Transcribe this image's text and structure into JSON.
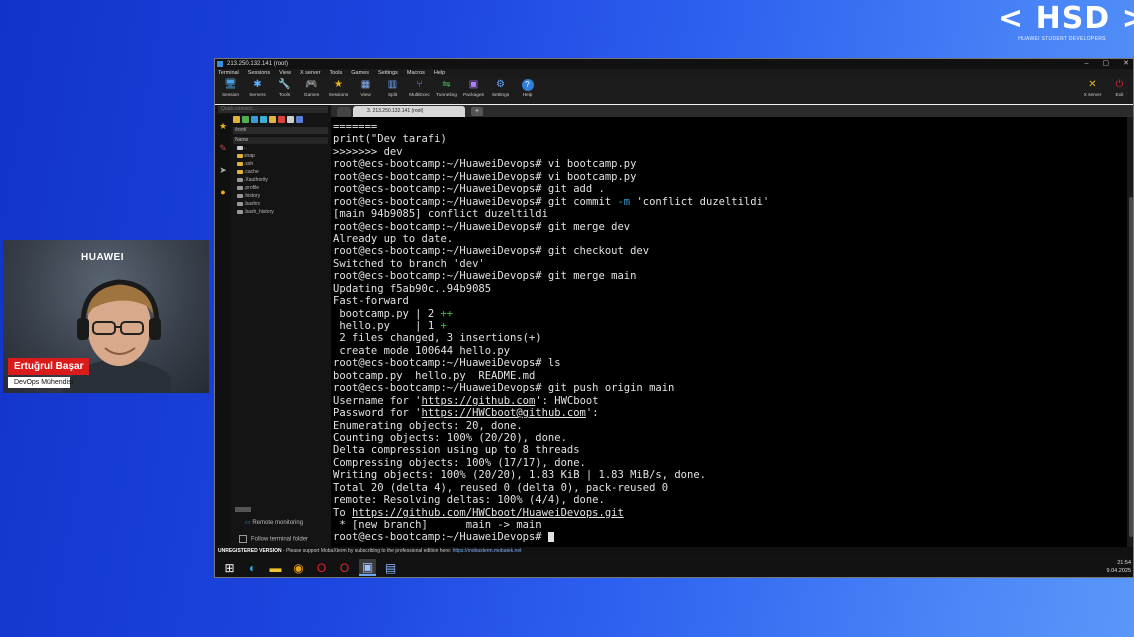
{
  "overlay": {
    "logo": "< HSD >",
    "logo_sub": "HUAWEI STUDENT DEVELOPERS"
  },
  "presenter": {
    "brand": "HUAWEI",
    "name": "Ertuğrul Başar",
    "role": "DevOps Mühendisi"
  },
  "window": {
    "title": "213.250.132.141 (root)",
    "controls": [
      "–",
      "▢",
      "✕"
    ]
  },
  "menu": [
    "Terminal",
    "Sessions",
    "View",
    "X server",
    "Tools",
    "Games",
    "Settings",
    "Macros",
    "Help"
  ],
  "toolbar": {
    "buttons": [
      {
        "label": "Session",
        "icon": "session-icon",
        "glyph": "🖥"
      },
      {
        "label": "Servers",
        "icon": "servers-icon",
        "glyph": "✱"
      },
      {
        "label": "Tools",
        "icon": "tools-icon",
        "glyph": "🔧"
      },
      {
        "label": "Games",
        "icon": "games-icon",
        "glyph": "🎮"
      },
      {
        "label": "Sessions",
        "icon": "star-icon",
        "glyph": "★"
      },
      {
        "label": "View",
        "icon": "view-icon",
        "glyph": "▦"
      },
      {
        "label": "Split",
        "icon": "split-icon",
        "glyph": "▥"
      },
      {
        "label": "MultiExec",
        "icon": "multiexec-icon",
        "glyph": "⑂"
      },
      {
        "label": "Tunneling",
        "icon": "tunneling-icon",
        "glyph": "⇋"
      },
      {
        "label": "Packages",
        "icon": "packages-icon",
        "glyph": "▣"
      },
      {
        "label": "Settings",
        "icon": "settings-icon",
        "glyph": "⚙"
      },
      {
        "label": "Help",
        "icon": "help-icon",
        "glyph": "?"
      }
    ],
    "right": [
      {
        "label": "X server",
        "icon": "xserver-icon",
        "glyph": "✕"
      },
      {
        "label": "Exit",
        "icon": "exit-icon",
        "glyph": "⏻"
      }
    ]
  },
  "sidebar": {
    "quick_connect_placeholder": "Quick connect...",
    "path": "/root/",
    "tree_header": "Name",
    "items": [
      {
        "name": "..",
        "color": "#cccccc"
      },
      {
        "name": "snap",
        "color": "#e0b33a"
      },
      {
        "name": ".ssh",
        "color": "#e0b33a"
      },
      {
        "name": ".cache",
        "color": "#e0b33a"
      },
      {
        "name": ".Xauthority",
        "color": "#9a9a9a"
      },
      {
        "name": ".profile",
        "color": "#9a9a9a"
      },
      {
        "name": ".history",
        "color": "#9a9a9a"
      },
      {
        "name": ".bashrc",
        "color": "#9a9a9a"
      },
      {
        "name": ".bash_history",
        "color": "#9a9a9a"
      }
    ],
    "remote_monitoring": "Remote monitoring",
    "follow_folder": "Follow terminal folder"
  },
  "tab": {
    "label": "3. 213.250.132.141 (root)"
  },
  "terminal": {
    "lines": [
      [
        {
          "t": "======="
        }
      ],
      [
        {
          "t": "print(\"Dev tarafi)"
        }
      ],
      [
        {
          "t": ">>>>>>> dev"
        }
      ],
      [
        {
          "t": "root@ecs-bootcamp:~/HuaweiDevops# vi bootcamp.py"
        }
      ],
      [
        {
          "t": "root@ecs-bootcamp:~/HuaweiDevops# vi bootcamp.py"
        }
      ],
      [
        {
          "t": "root@ecs-bootcamp:~/HuaweiDevops# git add ."
        }
      ],
      [
        {
          "t": "root@ecs-bootcamp:~/HuaweiDevops# git commit "
        },
        {
          "t": "-m",
          "c": "c"
        },
        {
          "t": " 'conflict duzeltildi'"
        }
      ],
      [
        {
          "t": "[main 94b9085] conflict duzeltildi"
        }
      ],
      [
        {
          "t": "root@ecs-bootcamp:~/HuaweiDevops# git merge dev"
        }
      ],
      [
        {
          "t": "Already up to date."
        }
      ],
      [
        {
          "t": "root@ecs-bootcamp:~/HuaweiDevops# git checkout dev"
        }
      ],
      [
        {
          "t": "Switched to branch 'dev'"
        }
      ],
      [
        {
          "t": "root@ecs-bootcamp:~/HuaweiDevops# git merge main"
        }
      ],
      [
        {
          "t": "Updating f5ab90c..94b9085"
        }
      ],
      [
        {
          "t": "Fast-forward"
        }
      ],
      [
        {
          "t": " bootcamp.py | 2 "
        },
        {
          "t": "++",
          "c": "g"
        }
      ],
      [
        {
          "t": " hello.py    | 1 "
        },
        {
          "t": "+",
          "c": "g"
        }
      ],
      [
        {
          "t": " 2 files changed, 3 insertions(+)"
        }
      ],
      [
        {
          "t": " create mode 100644 hello.py"
        }
      ],
      [
        {
          "t": "root@ecs-bootcamp:~/HuaweiDevops# ls"
        }
      ],
      [
        {
          "t": "bootcamp.py  hello.py  README.md"
        }
      ],
      [
        {
          "t": "root@ecs-bootcamp:~/HuaweiDevops# git push origin main"
        }
      ],
      [
        {
          "t": "Username for '"
        },
        {
          "t": "https://github.com",
          "c": "u"
        },
        {
          "t": "': HWCboot"
        }
      ],
      [
        {
          "t": "Password for '"
        },
        {
          "t": "https://HWCboot@github.com",
          "c": "u"
        },
        {
          "t": "':"
        }
      ],
      [
        {
          "t": "Enumerating objects: 20, done."
        }
      ],
      [
        {
          "t": "Counting objects: 100% (20/20), done."
        }
      ],
      [
        {
          "t": "Delta compression using up to 8 threads"
        }
      ],
      [
        {
          "t": "Compressing objects: 100% (17/17), done."
        }
      ],
      [
        {
          "t": "Writing objects: 100% (20/20), 1.83 KiB | 1.83 MiB/s, done."
        }
      ],
      [
        {
          "t": "Total 20 (delta 4), reused 0 (delta 0), pack-reused 0"
        }
      ],
      [
        {
          "t": "remote: Resolving deltas: 100% (4/4), done."
        }
      ],
      [
        {
          "t": "To "
        },
        {
          "t": "https://github.com/HWCboot/HuaweiDevops.git",
          "c": "u"
        }
      ],
      [
        {
          "t": " * [new branch]      main -> main"
        }
      ],
      [
        {
          "t": "root@ecs-bootcamp:~/HuaweiDevops# "
        },
        {
          "cursor": true
        }
      ]
    ]
  },
  "statusbar": {
    "bold": "UNREGISTERED VERSION",
    "text": "  -  Please support MobaXterm by subscribing to the professional edition here:  ",
    "link": "https://mobaxterm.mobatek.net"
  },
  "taskbar": {
    "items": [
      {
        "icon": "windows-start-icon",
        "glyph": "⊞",
        "color": "#ffffff"
      },
      {
        "icon": "edge-icon",
        "glyph": "◐",
        "color": "#36a3e0"
      },
      {
        "icon": "file-explorer-icon",
        "glyph": "▬",
        "color": "#f2c230"
      },
      {
        "icon": "chrome-icon",
        "glyph": "◉",
        "color": "#e8a020"
      },
      {
        "icon": "opera-icon",
        "glyph": "O",
        "color": "#e0262b"
      },
      {
        "icon": "opera-gx-icon",
        "glyph": "O",
        "color": "#e0262b"
      },
      {
        "icon": "mobaxterm-icon",
        "glyph": "▣",
        "color": "#9fc3ff",
        "active": true
      },
      {
        "icon": "app-icon",
        "glyph": "▤",
        "color": "#8ab4ff"
      }
    ],
    "time": "21:54",
    "date": "9.04.2025"
  }
}
